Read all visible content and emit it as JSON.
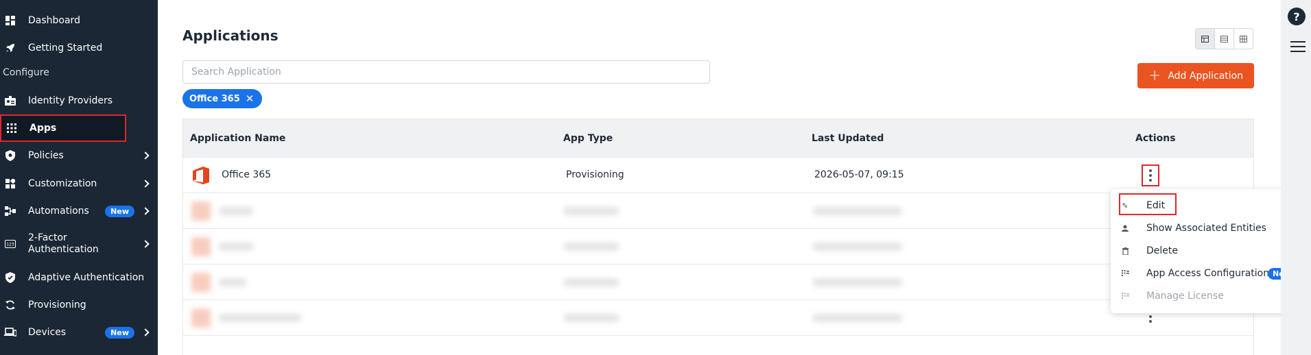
{
  "sidebar": {
    "items": [
      {
        "label": "Dashboard",
        "icon": "dashboard-icon"
      },
      {
        "label": "Getting Started",
        "icon": "rocket-icon"
      },
      {
        "label": "Identity Providers",
        "icon": "id-badge-icon"
      },
      {
        "label": "Apps",
        "icon": "apps-grid-icon"
      },
      {
        "label": "Policies",
        "icon": "shield-icon"
      },
      {
        "label": "Customization",
        "icon": "widgets-icon"
      },
      {
        "label": "Automations",
        "icon": "automation-icon",
        "badge": "New"
      },
      {
        "label": "2-Factor\nAuthentication",
        "icon": "123-icon"
      },
      {
        "label": "Adaptive Authentication",
        "icon": "shield-check-icon"
      },
      {
        "label": "Provisioning",
        "icon": "sync-icon"
      },
      {
        "label": "Devices",
        "icon": "devices-icon",
        "badge": "New"
      }
    ],
    "section_label": "Configure"
  },
  "main": {
    "title": "Applications",
    "search_placeholder": "Search Application",
    "add_button": "Add Application",
    "filter_chip": "Office 365",
    "view_modes": [
      "table-view-icon",
      "list-view-icon",
      "grid-view-icon"
    ]
  },
  "table": {
    "headers": [
      "Application Name",
      "App Type",
      "Last Updated",
      "Actions"
    ],
    "rows": [
      {
        "name": "Office 365",
        "type": "Provisioning",
        "updated": "2026-05-07, 09:15"
      }
    ]
  },
  "menu": {
    "items": [
      {
        "label": "Edit",
        "icon": "pencil-icon"
      },
      {
        "label": "Show Associated Entities",
        "icon": "user-icon"
      },
      {
        "label": "Delete",
        "icon": "trash-icon"
      },
      {
        "label": "App Access Configuration",
        "icon": "access-icon",
        "badge": "New"
      },
      {
        "label": "Manage License",
        "icon": "license-icon",
        "disabled": true
      }
    ]
  },
  "colors": {
    "sidebar_bg": "#1b2734",
    "accent_orange": "#ea5421",
    "accent_blue": "#1a73e8",
    "highlight_red": "#e0262b"
  },
  "rail": {
    "help_label": "?"
  }
}
